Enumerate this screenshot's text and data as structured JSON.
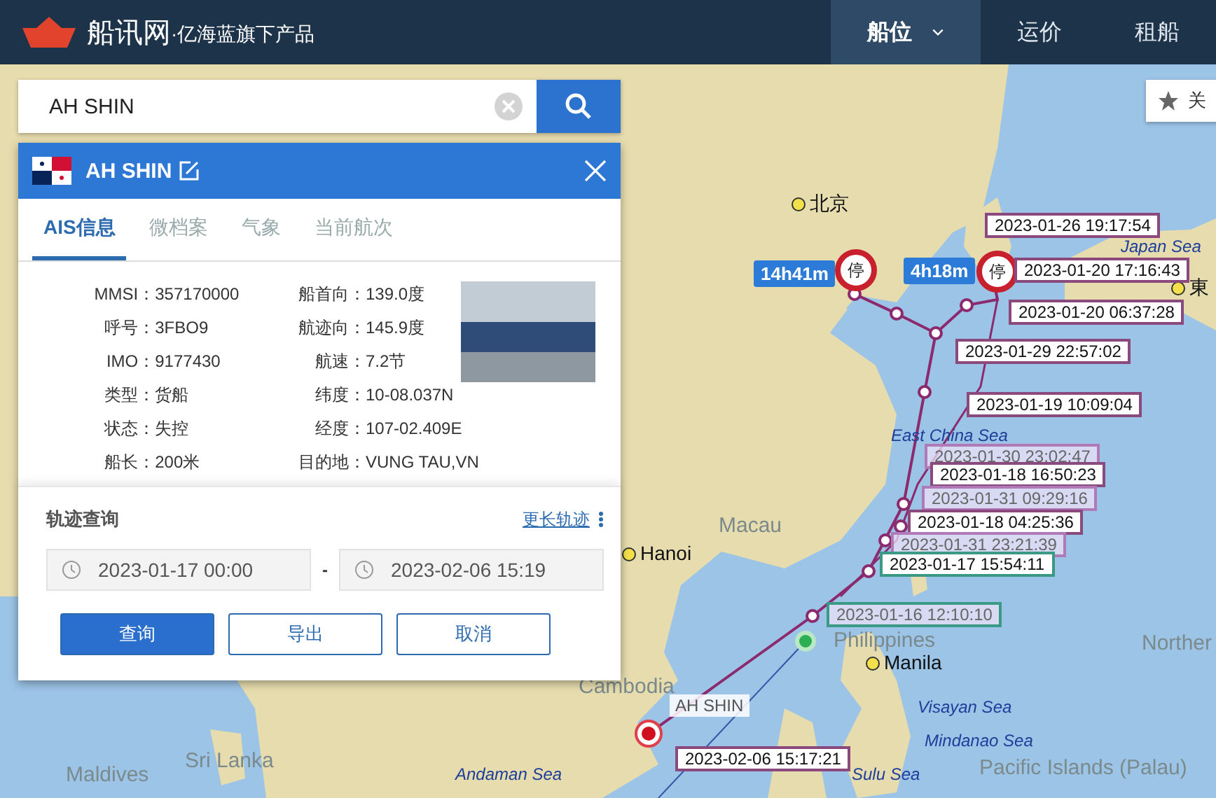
{
  "header": {
    "logo_text": "船讯网",
    "tagline": "·亿海蓝旗下产品",
    "nav": [
      {
        "label": "船位",
        "selected": true,
        "dropdown": true
      },
      {
        "label": "运价",
        "selected": false,
        "dropdown": false
      },
      {
        "label": "租船",
        "selected": false,
        "dropdown": false
      }
    ]
  },
  "search": {
    "value": "AH SHIN"
  },
  "follow_button": {
    "label": "关"
  },
  "ship_panel": {
    "title": "AH SHIN",
    "tabs": [
      {
        "label": "AIS信息",
        "selected": true
      },
      {
        "label": "微档案",
        "selected": false
      },
      {
        "label": "气象",
        "selected": false
      },
      {
        "label": "当前航次",
        "selected": false
      }
    ],
    "fields_left": [
      {
        "label": "MMSI：",
        "value": "357170000"
      },
      {
        "label": "呼号：",
        "value": "3FBO9"
      },
      {
        "label": "IMO：",
        "value": "9177430"
      },
      {
        "label": "类型：",
        "value": "货船"
      },
      {
        "label": "状态：",
        "value": "失控"
      },
      {
        "label": "船长：",
        "value": "200米"
      }
    ],
    "fields_right": [
      {
        "label": "船首向：",
        "value": "139.0度"
      },
      {
        "label": "航迹向：",
        "value": "145.9度"
      },
      {
        "label": "航速：",
        "value": "7.2节"
      },
      {
        "label": "纬度：",
        "value": "10-08.037N"
      },
      {
        "label": "经度：",
        "value": "107-02.409E"
      },
      {
        "label": "目的地：",
        "value": "VUNG TAU,VN"
      }
    ]
  },
  "track_query": {
    "title": "轨迹查询",
    "more_link": "更长轨迹",
    "start": "2023-01-17 00:00",
    "separator": "-",
    "end": "2023-02-06 15:19",
    "buttons": [
      {
        "label": "查询",
        "kind": "primary"
      },
      {
        "label": "导出",
        "kind": "outline"
      },
      {
        "label": "取消",
        "kind": "outline"
      }
    ]
  },
  "map": {
    "places": [
      {
        "text": "北京",
        "kind": "city"
      },
      {
        "text": "Japan Sea",
        "kind": "sea"
      },
      {
        "text": "東",
        "kind": "city"
      },
      {
        "text": "East China Sea",
        "kind": "sea"
      },
      {
        "text": "Macau",
        "kind": "region"
      },
      {
        "text": "Hanoi",
        "kind": "city"
      },
      {
        "text": "Philippines",
        "kind": "region"
      },
      {
        "text": "Norther",
        "kind": "region"
      },
      {
        "text": "Manila",
        "kind": "city"
      },
      {
        "text": "Cambodia",
        "kind": "region"
      },
      {
        "text": "Visayan Sea",
        "kind": "sea"
      },
      {
        "text": "Mindanao Sea",
        "kind": "sea"
      },
      {
        "text": "Maldives",
        "kind": "region"
      },
      {
        "text": "Sri Lanka",
        "kind": "region"
      },
      {
        "text": "Andaman Sea",
        "kind": "sea"
      },
      {
        "text": "Sulu Sea",
        "kind": "sea"
      },
      {
        "text": "Pacific Islands (Palau)",
        "kind": "region"
      }
    ],
    "stops": [
      {
        "duration": "14h41m",
        "marker": "停"
      },
      {
        "duration": "4h18m",
        "marker": "停"
      }
    ],
    "ship_label": "AH SHIN",
    "track_labels": [
      {
        "text": "2023-01-26 19:17:54",
        "color": "#8b4a7e",
        "faded": false
      },
      {
        "text": "2023-01-20 17:16:43",
        "color": "#8b4a7e",
        "faded": false
      },
      {
        "text": "2023-01-20 06:37:28",
        "color": "#8b4a7e",
        "faded": false
      },
      {
        "text": "2023-01-29 22:57:02",
        "color": "#8b4a7e",
        "faded": false
      },
      {
        "text": "2023-01-19 10:09:04",
        "color": "#8b4a7e",
        "faded": false
      },
      {
        "text": "2023-01-30 23:02:47",
        "color": "#b07ab8",
        "faded": true
      },
      {
        "text": "2023-01-18 16:50:23",
        "color": "#8b4a7e",
        "faded": false
      },
      {
        "text": "2023-01-31 09:29:16",
        "color": "#b07ab8",
        "faded": true
      },
      {
        "text": "2023-01-18 04:25:36",
        "color": "#8b4a7e",
        "faded": false
      },
      {
        "text": "2023-01-31 23:21:39",
        "color": "#b07ab8",
        "faded": true
      },
      {
        "text": "2023-01-17 15:54:11",
        "color": "#3a9a86",
        "faded": false
      },
      {
        "text": "2023-01-16 12:10:10",
        "color": "#3a9a86",
        "faded": true
      },
      {
        "text": "2023-02-06 15:17:21",
        "color": "#8b4a7e",
        "faded": false
      }
    ]
  }
}
